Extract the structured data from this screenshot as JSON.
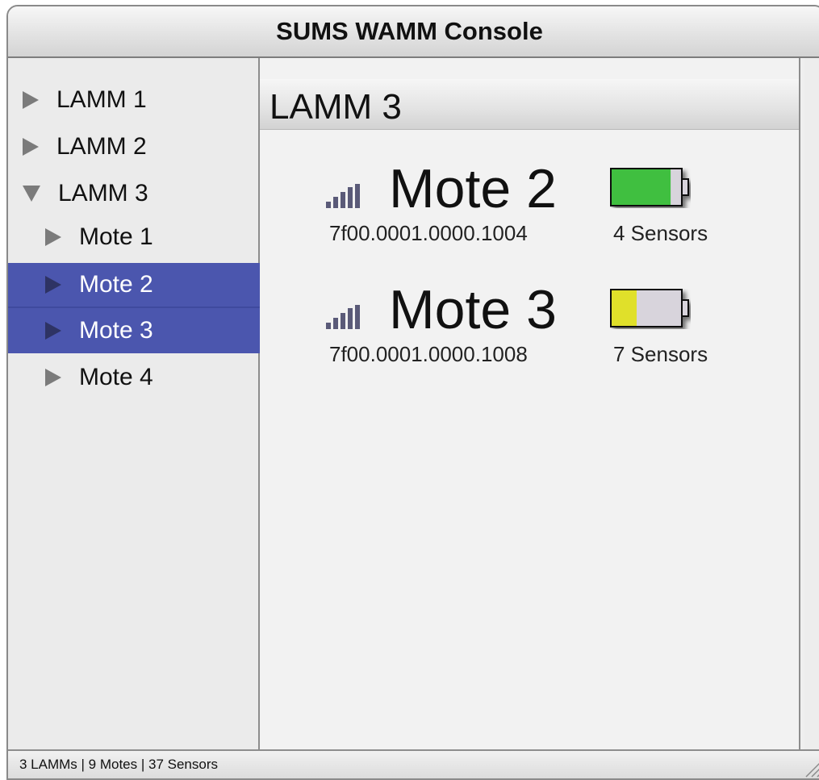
{
  "window": {
    "title": "SUMS WAMM Console"
  },
  "sidebar": {
    "items": [
      {
        "label": "LAMM 1",
        "expanded": false,
        "selected": false,
        "level": 0
      },
      {
        "label": "LAMM 2",
        "expanded": false,
        "selected": false,
        "level": 0
      },
      {
        "label": "LAMM 3",
        "expanded": true,
        "selected": false,
        "level": 0
      },
      {
        "label": "Mote 1",
        "expanded": false,
        "selected": false,
        "level": 1
      },
      {
        "label": "Mote 2",
        "expanded": false,
        "selected": true,
        "level": 1
      },
      {
        "label": "Mote 3",
        "expanded": false,
        "selected": true,
        "level": 1
      },
      {
        "label": "Mote 4",
        "expanded": false,
        "selected": false,
        "level": 1
      }
    ]
  },
  "main": {
    "header": "LAMM 3",
    "motes": [
      {
        "name": "Mote 2",
        "id": "7f00.0001.0000.1004",
        "sensors": "4 Sensors",
        "battery_level": 0.85,
        "battery_color": "#3fbf3f",
        "signal_icon": "signal-strength-icon"
      },
      {
        "name": "Mote 3",
        "id": "7f00.0001.0000.1008",
        "sensors": "7 Sensors",
        "battery_level": 0.36,
        "battery_color": "#e0e02a",
        "signal_icon": "signal-strength-icon"
      }
    ]
  },
  "status": {
    "text": "3 LAMMs | 9 Motes | 37 Sensors"
  },
  "colors": {
    "selection": "#4b56ae",
    "battery_empty": "#d8d4dc"
  }
}
